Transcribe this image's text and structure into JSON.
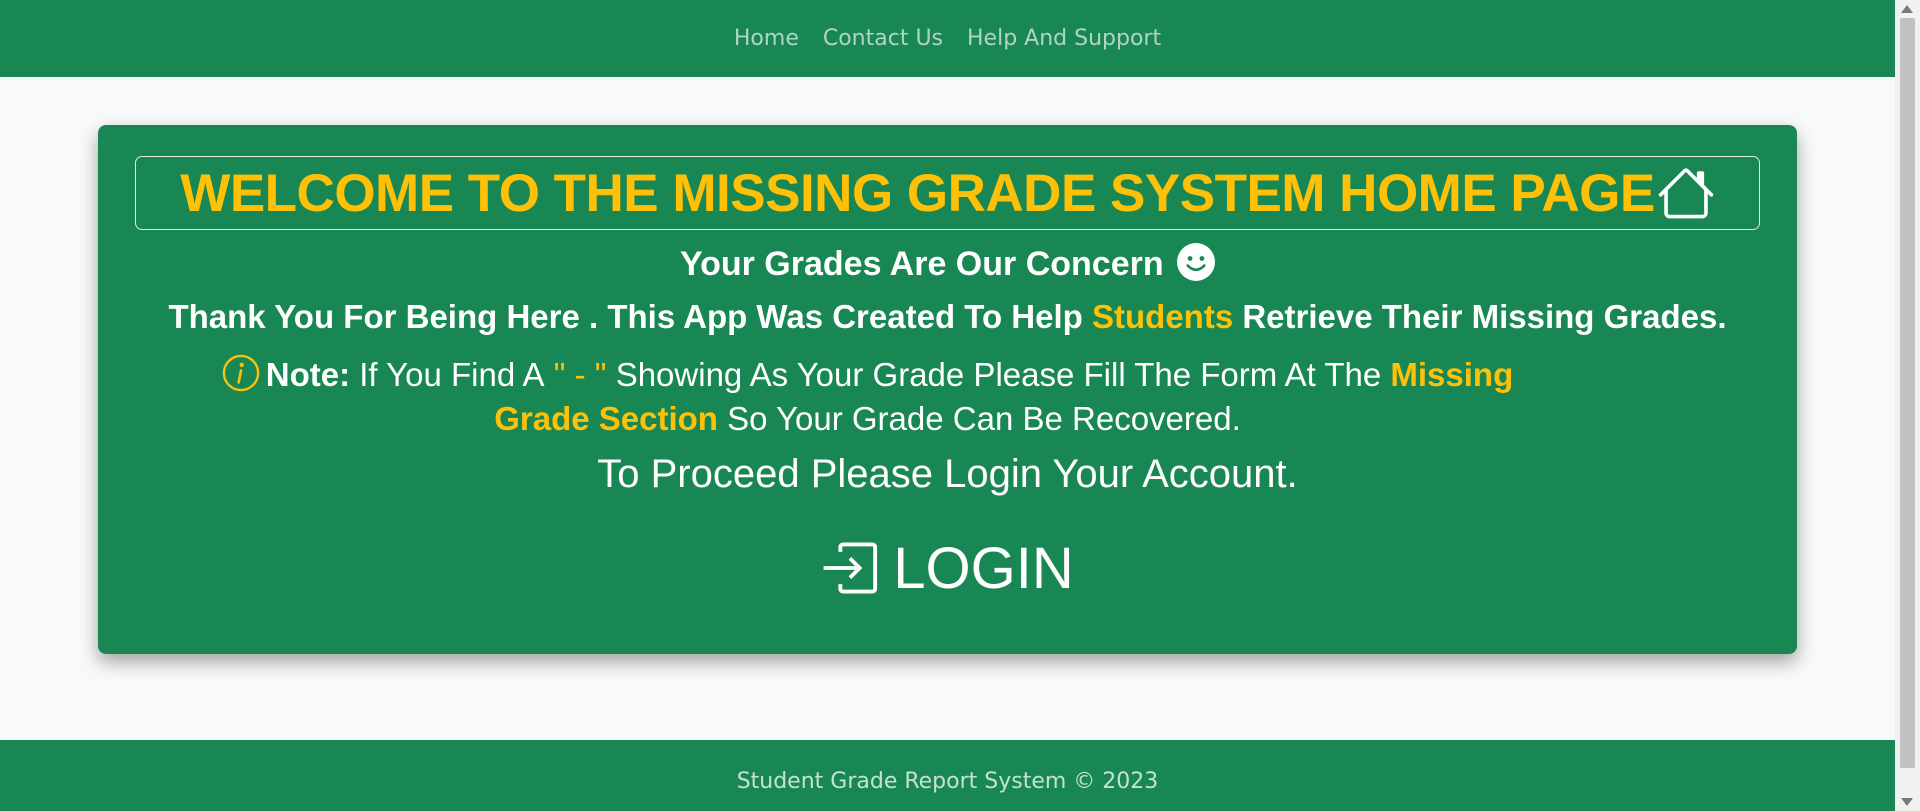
{
  "nav": {
    "items": [
      {
        "label": "Home"
      },
      {
        "label": "Contact Us"
      },
      {
        "label": "Help And Support"
      }
    ]
  },
  "hero": {
    "title": "WELCOME TO THE MISSING GRADE SYSTEM HOME PAGE",
    "title_icon": "house-icon",
    "tagline": "Your Grades Are Our Concern",
    "tagline_icon": "smile-icon",
    "thanks_prefix": "Thank You For Being Here . This App Was Created To Help",
    "thanks_highlight": "Students",
    "thanks_suffix": "Retrieve Their Missing Grades.",
    "note_icon": "info-icon",
    "note_label": "Note:",
    "note_prefix": "If You Find A",
    "note_dash": "\" - \"",
    "note_middle": "Showing As Your Grade Please Fill The Form At The",
    "note_highlight": "Missing Grade Section",
    "note_suffix": "So Your Grade Can Be Recovered.",
    "proceed": "To Proceed Please Login Your Account.",
    "login_label": "LOGIN",
    "login_icon": "login-icon"
  },
  "footer": {
    "text": "Student Grade Report System © 2023"
  },
  "colors": {
    "primary_green": "#198754",
    "accent_gold": "#ffc107",
    "page_background": "#f8f9fa"
  }
}
